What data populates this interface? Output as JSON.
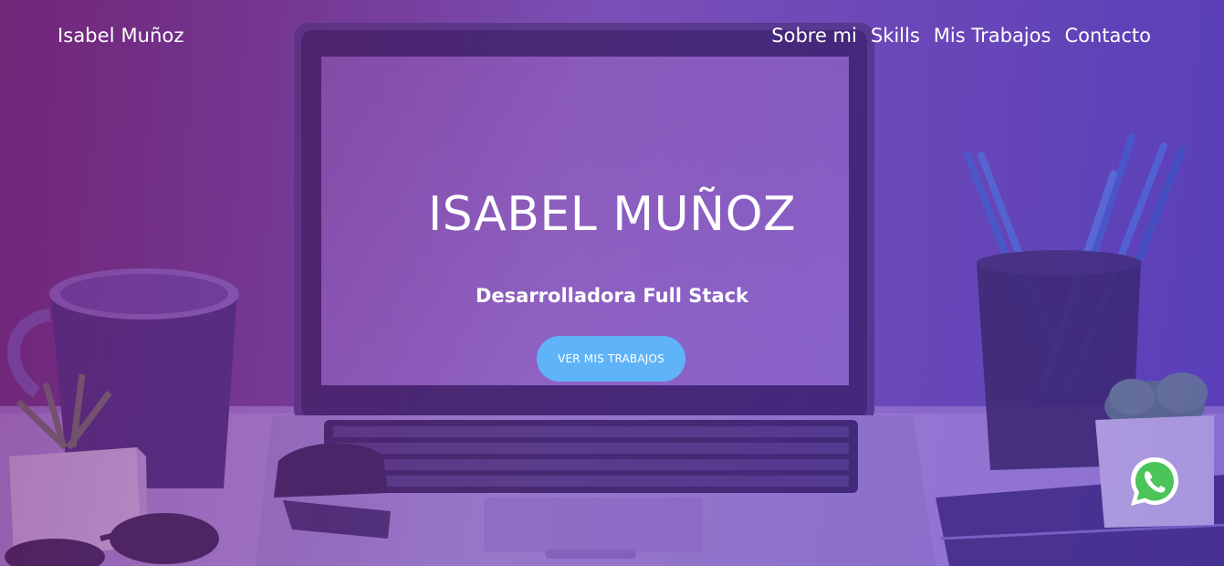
{
  "nav": {
    "brand": "Isabel Muñoz",
    "links": [
      "Sobre mi",
      "Skills",
      "Mis Trabajos",
      "Contacto"
    ]
  },
  "hero": {
    "title": "ISABEL MUÑOZ",
    "subtitle": "Desarrolladora Full Stack",
    "cta_label": "VER MIS TRABAJOS"
  },
  "floating": {
    "whatsapp_icon": "whatsapp-icon"
  },
  "colors": {
    "overlay_left": "#76307e",
    "overlay_right": "#5a3fc0",
    "cta_bg": "#5fb4f8",
    "whatsapp_green": "#4bc45a",
    "text": "#ffffff"
  }
}
